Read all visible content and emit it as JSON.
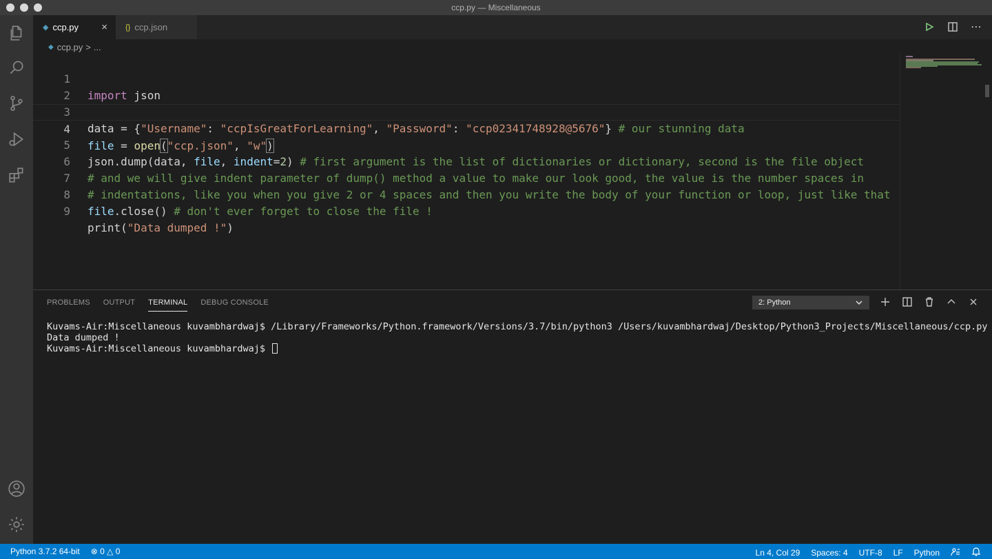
{
  "window": {
    "title": "ccp.py — Miscellaneous"
  },
  "activity_bar": {
    "items": [
      "explorer-icon",
      "search-icon",
      "source-control-icon",
      "run-debug-icon",
      "extensions-icon"
    ],
    "bottom": [
      "account-icon",
      "gear-icon"
    ]
  },
  "tabs": [
    {
      "label": "ccp.py",
      "icon": "python-icon",
      "active": true
    },
    {
      "label": "ccp.json",
      "icon": "{}",
      "active": false
    }
  ],
  "breadcrumb": {
    "file": "ccp.py",
    "separator": ">",
    "rest": "..."
  },
  "editor": {
    "current_line": 4,
    "line_numbers": [
      "1",
      "2",
      "3",
      "4",
      "5",
      "6",
      "7",
      "8",
      "9"
    ],
    "l1": {
      "kw": "import",
      "rest": " json"
    },
    "l3": {
      "a": "data = {",
      "s1": "\"Username\"",
      "b": ": ",
      "s2": "\"ccpIsGreatForLearning\"",
      "c": ", ",
      "s3": "\"Password\"",
      "d": ": ",
      "s4": "\"ccp02341748928@5676\"",
      "e": "} ",
      "cmt": "# our stunning data"
    },
    "l4": {
      "var": "file",
      "a": " = ",
      "fn": "open",
      "p1": "(",
      "s1": "\"ccp.json\"",
      "b": ", ",
      "s2": "\"w\"",
      "p2": ")"
    },
    "l5": {
      "a": "json.dump(data, ",
      "var1": "file",
      "b": ", ",
      "var2": "indent",
      "c": "=",
      "num": "2",
      "d": ") ",
      "cmt": "# first argument is the list of dictionaries or dictionary, second is the file object"
    },
    "l6": {
      "cmt": "# and we will give indent parameter of dump() method a value to make our look good, the value is the number spaces in"
    },
    "l7": {
      "cmt": "# indentations, like you when you give 2 or 4 spaces and then you write the body of your function or loop, just like that"
    },
    "l8": {
      "var": "file",
      "a": ".close() ",
      "cmt": "# don't ever forget to close the file !"
    },
    "l9": {
      "a": "print(",
      "s": "\"Data dumped !\"",
      "b": ")"
    }
  },
  "panel": {
    "tabs": [
      "PROBLEMS",
      "OUTPUT",
      "TERMINAL",
      "DEBUG CONSOLE"
    ],
    "active_tab": "TERMINAL",
    "terminal_select": "2: Python",
    "actions": [
      "plus-icon",
      "split-icon",
      "trash-icon",
      "chevron-up-icon",
      "close-icon"
    ],
    "terminal_lines": [
      "Kuvams-Air:Miscellaneous kuvambhardwaj$ /Library/Frameworks/Python.framework/Versions/3.7/bin/python3 /Users/kuvambhardwaj/Desktop/Python3_Projects/Miscellaneous/ccp.py",
      "Data dumped !",
      "Kuvams-Air:Miscellaneous kuvambhardwaj$ "
    ]
  },
  "statusbar": {
    "interpreter": "Python 3.7.2 64-bit",
    "errors": "0",
    "warnings": "0",
    "position": "Ln 4, Col 29",
    "spaces": "Spaces: 4",
    "encoding": "UTF-8",
    "eol": "LF",
    "language": "Python",
    "color": "#007acc"
  }
}
